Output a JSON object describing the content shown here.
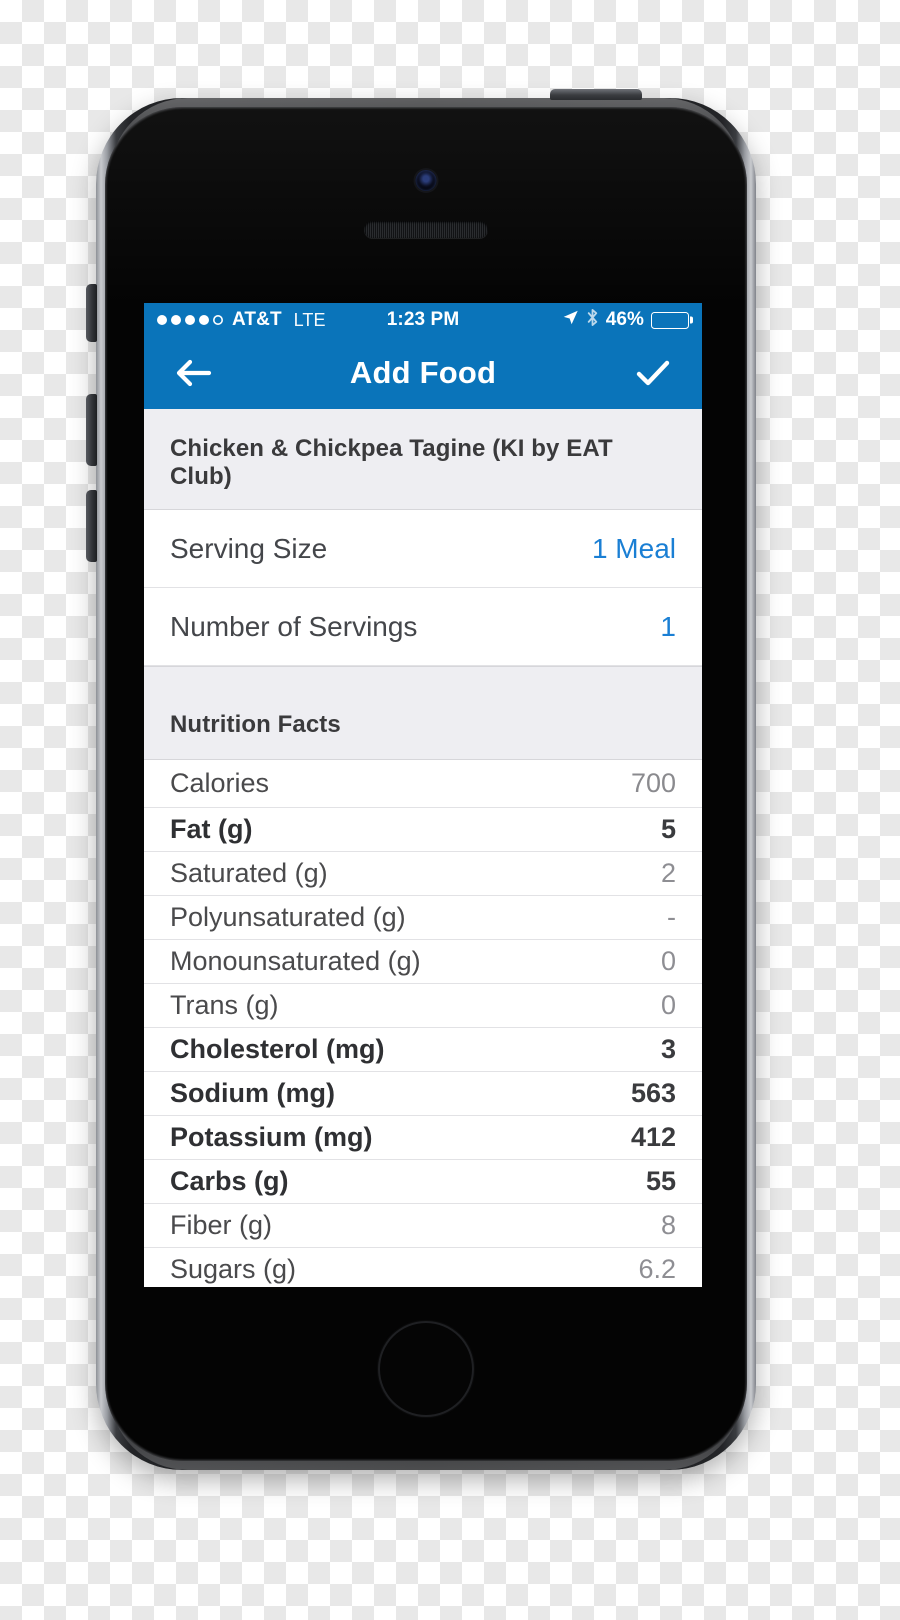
{
  "status_bar": {
    "signal_dots": {
      "filled": 4,
      "empty": 1
    },
    "carrier": "AT&T",
    "network": "LTE",
    "time": "1:23 PM",
    "location_icon": "location-arrow-icon",
    "bluetooth_icon": "bluetooth-icon",
    "battery_percent": "46%",
    "battery_level": 46
  },
  "nav_bar": {
    "back_icon": "back-arrow-icon",
    "title": "Add Food",
    "confirm_icon": "checkmark-icon"
  },
  "food": {
    "name": "Chicken & Chickpea Tagine (KI by EAT Club)",
    "serving_size_label": "Serving Size",
    "serving_size_value": "1 Meal",
    "number_of_servings_label": "Number of Servings",
    "number_of_servings_value": "1"
  },
  "nutrition": {
    "section_title": "Nutrition Facts",
    "rows": [
      {
        "label": "Calories",
        "value": "700",
        "bold": false,
        "lead": true
      },
      {
        "label": "Fat (g)",
        "value": "5",
        "bold": true,
        "lead": false
      },
      {
        "label": "Saturated (g)",
        "value": "2",
        "bold": false,
        "lead": false
      },
      {
        "label": "Polyunsaturated (g)",
        "value": "-",
        "bold": false,
        "lead": false
      },
      {
        "label": "Monounsaturated (g)",
        "value": "0",
        "bold": false,
        "lead": false
      },
      {
        "label": "Trans (g)",
        "value": "0",
        "bold": false,
        "lead": false
      },
      {
        "label": "Cholesterol (mg)",
        "value": "3",
        "bold": true,
        "lead": false
      },
      {
        "label": "Sodium (mg)",
        "value": "563",
        "bold": true,
        "lead": false
      },
      {
        "label": "Potassium (mg)",
        "value": "412",
        "bold": true,
        "lead": false
      },
      {
        "label": "Carbs (g)",
        "value": "55",
        "bold": true,
        "lead": false
      },
      {
        "label": "Fiber (g)",
        "value": "8",
        "bold": false,
        "lead": false
      },
      {
        "label": "Sugars (g)",
        "value": "6.2",
        "bold": false,
        "lead": false
      }
    ]
  },
  "colors": {
    "brand_blue": "#0a74ba",
    "accent_value_blue": "#1a7fd4",
    "section_bg": "#eeeef2",
    "value_gray": "#8e8e93"
  },
  "hardware": {
    "camera": "front-camera",
    "earpiece": "earpiece-speaker",
    "home_button": "home-button",
    "power_button": "power-button",
    "mute_switch": "mute-switch",
    "volume_up": "volume-up-button",
    "volume_down": "volume-down-button"
  }
}
